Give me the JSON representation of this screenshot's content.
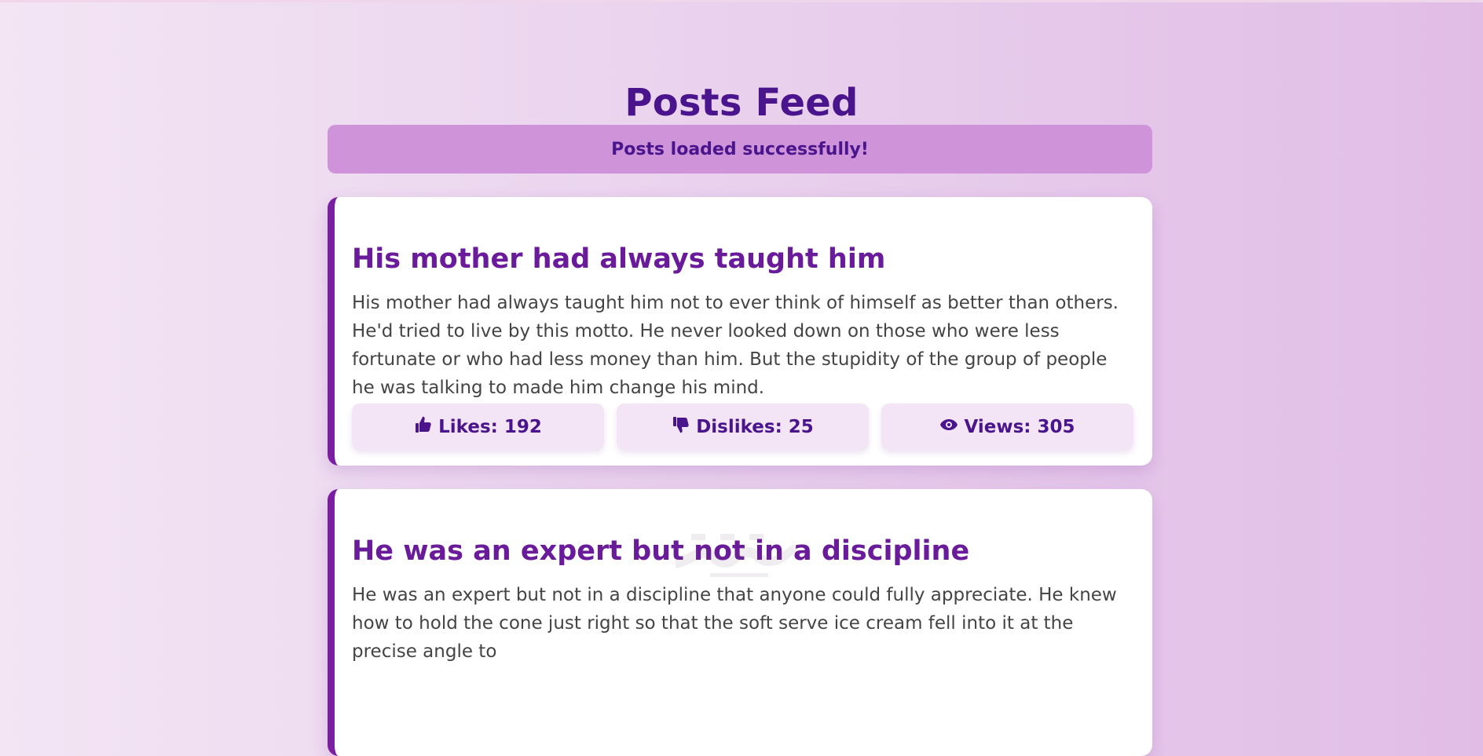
{
  "page": {
    "title": "Posts Feed",
    "status_message": "Posts loaded successfully!"
  },
  "posts": [
    {
      "title": "His mother had always taught him",
      "body": "His mother had always taught him not to ever think of himself as better than others. He'd tried to live by this motto. He never looked down on those who were less fortunate or who had less money than him. But the stupidity of the group of people he was talking to made him change his mind.",
      "stats": {
        "likes": "Likes: 192",
        "dislikes": "Dislikes: 25",
        "views": "Views: 305"
      }
    },
    {
      "title": "He was an expert but not in a discipline",
      "body": "He was an expert but not in a discipline that anyone could fully appreciate. He knew how to hold the cone just right so that the soft serve ice cream fell into it at the precise angle to"
    }
  ],
  "theme": {
    "accent": "#7b1fa2",
    "title_color": "#4a148c",
    "banner_background": "#ce93d8",
    "card_background": "#ffffff",
    "stat_background": "#f3e5f5"
  },
  "icons": {
    "likes": "thumbs-up-icon",
    "dislikes": "thumbs-down-icon",
    "views": "eye-icon"
  }
}
